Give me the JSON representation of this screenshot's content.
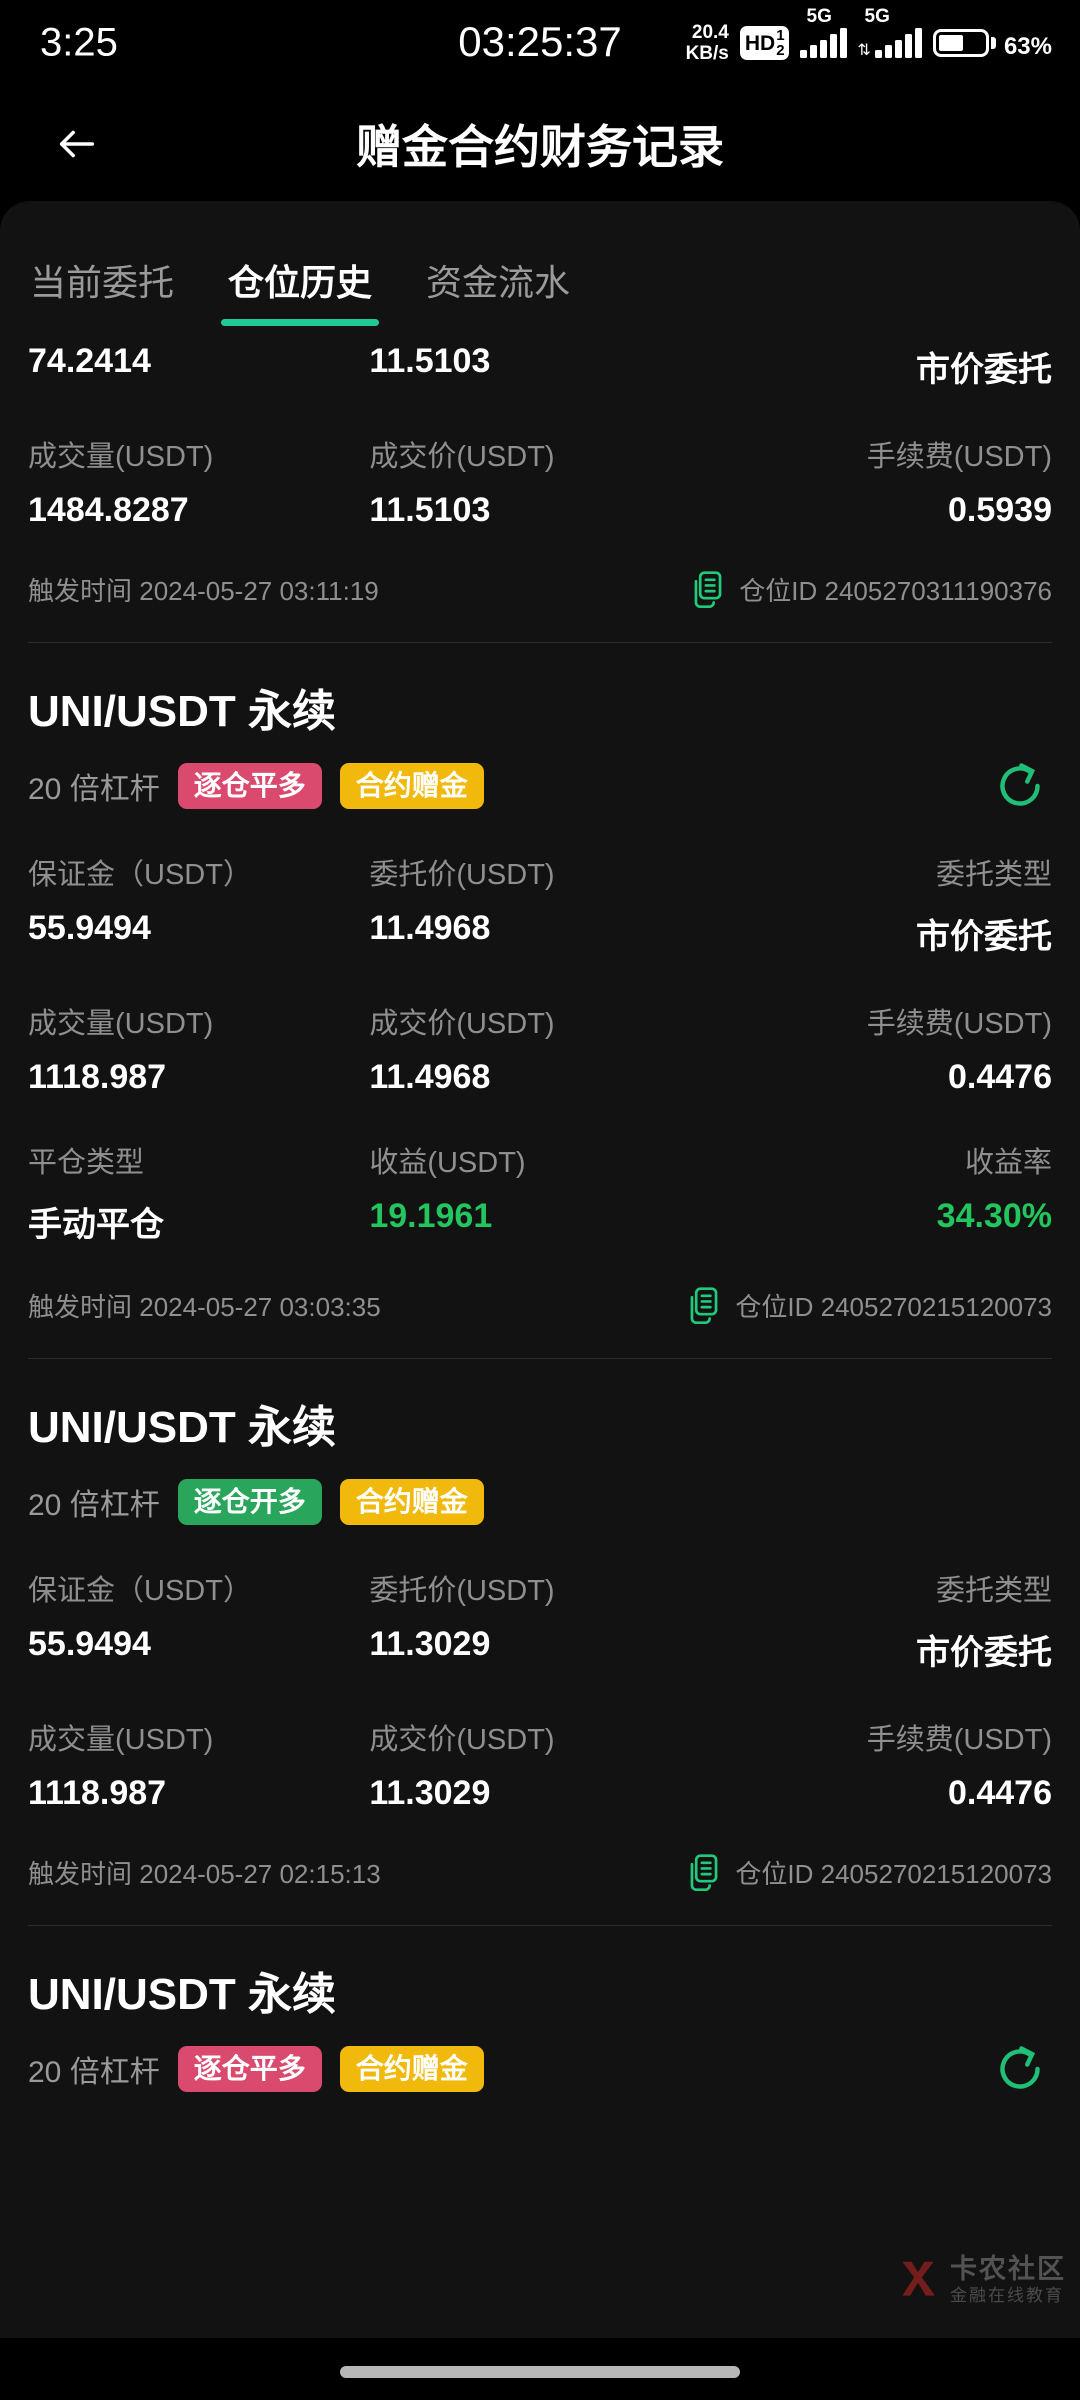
{
  "status_bar": {
    "clock": "3:25",
    "center_time": "03:25:37",
    "net_speed_value": "20.4",
    "net_speed_unit": "KB/s",
    "hd_label": "HD",
    "hd_sim_top": "1",
    "hd_sim_bottom": "2",
    "network_1": "5G",
    "network_2": "5G",
    "battery_percent": "63",
    "battery_percent_symbol": "%"
  },
  "appbar": {
    "back_icon": "arrow-left-icon",
    "title": "赠金合约财务记录"
  },
  "tabs": [
    {
      "label": "当前委托",
      "active": false
    },
    {
      "label": "仓位历史",
      "active": true
    },
    {
      "label": "资金流水",
      "active": false
    }
  ],
  "colors": {
    "accent_green": "#20c997",
    "profit_green": "#22c55e",
    "badge_pink": "#d94a6e",
    "badge_green": "#2aa65c",
    "badge_amber": "#f0b90b",
    "sheet_bg": "#121212",
    "page_bg": "#000000"
  },
  "records": [
    {
      "partial": true,
      "rows": [
        {
          "values": [
            "74.2414",
            "11.5103",
            "市价委托"
          ]
        },
        {
          "labels": [
            "成交量(USDT)",
            "成交价(USDT)",
            "手续费(USDT)"
          ],
          "values": [
            "1484.8287",
            "11.5103",
            "0.5939"
          ]
        }
      ],
      "trigger_label": "触发时间",
      "trigger_time": "2024-05-27 03:11:19",
      "posid_label": "仓位ID",
      "posid_value": "2405270311190376",
      "copy_icon": "copy-icon"
    },
    {
      "symbol": "UNI/USDT 永续",
      "leverage": "20 倍杠杆",
      "badges": [
        {
          "text": "逐仓平多",
          "style": "pink"
        },
        {
          "text": "合约赠金",
          "style": "amber"
        }
      ],
      "refresh_icon": "refresh-icon",
      "rows": [
        {
          "labels": [
            "保证金（USDT）",
            "委托价(USDT)",
            "委托类型"
          ],
          "values": [
            "55.9494",
            "11.4968",
            "市价委托"
          ]
        },
        {
          "labels": [
            "成交量(USDT)",
            "成交价(USDT)",
            "手续费(USDT)"
          ],
          "values": [
            "1118.987",
            "11.4968",
            "0.4476"
          ]
        },
        {
          "labels": [
            "平仓类型",
            "收益(USDT)",
            "收益率"
          ],
          "values": [
            "手动平仓",
            "19.1961",
            "34.30%"
          ],
          "value_colors": [
            "white",
            "green",
            "green"
          ]
        }
      ],
      "trigger_label": "触发时间",
      "trigger_time": "2024-05-27 03:03:35",
      "posid_label": "仓位ID",
      "posid_value": "2405270215120073",
      "copy_icon": "copy-icon"
    },
    {
      "symbol": "UNI/USDT 永续",
      "leverage": "20 倍杠杆",
      "badges": [
        {
          "text": "逐仓开多",
          "style": "green"
        },
        {
          "text": "合约赠金",
          "style": "amber"
        }
      ],
      "rows": [
        {
          "labels": [
            "保证金（USDT）",
            "委托价(USDT)",
            "委托类型"
          ],
          "values": [
            "55.9494",
            "11.3029",
            "市价委托"
          ]
        },
        {
          "labels": [
            "成交量(USDT)",
            "成交价(USDT)",
            "手续费(USDT)"
          ],
          "values": [
            "1118.987",
            "11.3029",
            "0.4476"
          ]
        }
      ],
      "trigger_label": "触发时间",
      "trigger_time": "2024-05-27 02:15:13",
      "posid_label": "仓位ID",
      "posid_value": "2405270215120073",
      "copy_icon": "copy-icon"
    },
    {
      "symbol": "UNI/USDT 永续",
      "leverage": "20 倍杠杆",
      "badges": [
        {
          "text": "逐仓平多",
          "style": "pink"
        },
        {
          "text": "合约赠金",
          "style": "amber"
        }
      ],
      "refresh_icon": "refresh-icon",
      "truncated": true
    }
  ],
  "watermark": {
    "main": "卡农社区",
    "sub": "金融在线教育"
  }
}
